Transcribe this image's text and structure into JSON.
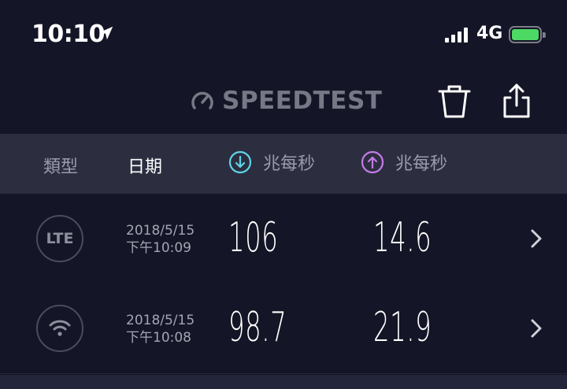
{
  "status": {
    "time": "10:10",
    "network": "4G"
  },
  "header": {
    "logo_text": "SPEEDTEST"
  },
  "table_header": {
    "type_label": "類型",
    "date_label": "日期",
    "download_label": "兆每秒",
    "upload_label": "兆每秒"
  },
  "results": [
    {
      "type": "LTE",
      "date": "2018/5/15",
      "time": "下午10:09",
      "download": "106",
      "upload": "14.6"
    },
    {
      "type": "wifi",
      "date": "2018/5/15",
      "time": "下午10:08",
      "download": "98.7",
      "upload": "21.9"
    }
  ],
  "colors": {
    "background": "#141526",
    "header_band": "#2c2e40",
    "download_accent": "#5fd3e6",
    "upload_accent": "#c47be6",
    "battery": "#4cd964"
  }
}
